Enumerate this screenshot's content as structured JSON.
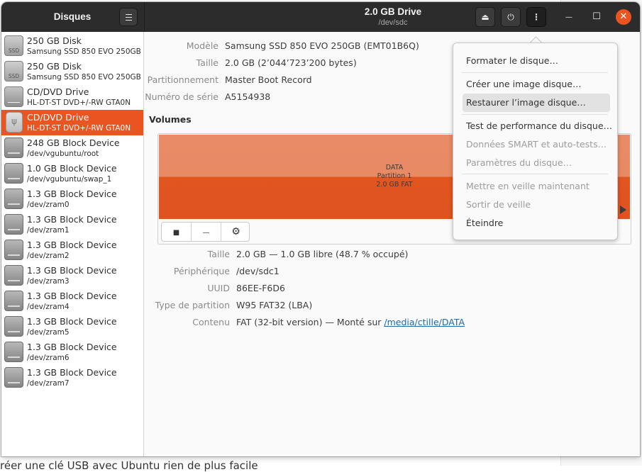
{
  "background": {
    "bottom_text": "réer une clé USB avec Ubuntu rien de plus facile"
  },
  "sidebar_header": {
    "title": "Disques",
    "menu_icon": "hamburger-icon"
  },
  "header": {
    "title": "2.0 GB Drive",
    "subtitle": "/dev/sdc",
    "eject_glyph": "⏏",
    "power_glyph": "⏻",
    "more_glyph": "⋮",
    "minimize_glyph": "—",
    "maximize_glyph": "☐",
    "close_glyph": "✕"
  },
  "devices": [
    {
      "name": "250 GB Disk",
      "sub": "Samsung SSD 850 EVO 250GB",
      "icon": "ssd",
      "icon_label": "SSD"
    },
    {
      "name": "250 GB Disk",
      "sub": "Samsung SSD 850 EVO 250GB",
      "icon": "ssd",
      "icon_label": "SSD"
    },
    {
      "name": "CD/DVD Drive",
      "sub": "HL-DT-ST DVD+/-RW GTA0N",
      "icon": "disc",
      "icon_label": ""
    },
    {
      "name": "CD/DVD Drive",
      "sub": "HL-DT-ST DVD+/-RW GTA0N",
      "icon": "usb",
      "icon_label": "ψ"
    },
    {
      "name": "248 GB Block Device",
      "sub": "/dev/vgubuntu/root",
      "icon": "block",
      "icon_label": ""
    },
    {
      "name": "1.0 GB Block Device",
      "sub": "/dev/vgubuntu/swap_1",
      "icon": "block",
      "icon_label": ""
    },
    {
      "name": "1.3 GB Block Device",
      "sub": "/dev/zram0",
      "icon": "block",
      "icon_label": ""
    },
    {
      "name": "1.3 GB Block Device",
      "sub": "/dev/zram1",
      "icon": "block",
      "icon_label": ""
    },
    {
      "name": "1.3 GB Block Device",
      "sub": "/dev/zram2",
      "icon": "block",
      "icon_label": ""
    },
    {
      "name": "1.3 GB Block Device",
      "sub": "/dev/zram3",
      "icon": "block",
      "icon_label": ""
    },
    {
      "name": "1.3 GB Block Device",
      "sub": "/dev/zram4",
      "icon": "block",
      "icon_label": ""
    },
    {
      "name": "1.3 GB Block Device",
      "sub": "/dev/zram5",
      "icon": "block",
      "icon_label": ""
    },
    {
      "name": "1.3 GB Block Device",
      "sub": "/dev/zram6",
      "icon": "block",
      "icon_label": ""
    },
    {
      "name": "1.3 GB Block Device",
      "sub": "/dev/zram7",
      "icon": "block",
      "icon_label": ""
    }
  ],
  "selected_device": 3,
  "drive_info": {
    "model_label": "Modèle",
    "model_value": "Samsung SSD 850 EVO 250GB (EMT01B6Q)",
    "size_label": "Taille",
    "size_value": "2.0 GB (2’044’723’200 bytes)",
    "partitioning_label": "Partitionnement",
    "partitioning_value": "Master Boot Record",
    "serial_label": "Numéro de série",
    "serial_value": "A5154938"
  },
  "volumes": {
    "title": "Volumes",
    "partition_name": "DATA",
    "partition_number": "Partition 1",
    "partition_size_fs": "2.0 GB FAT",
    "toolbar": {
      "stop_glyph": "■",
      "minus_glyph": "—",
      "gear_glyph": "⚙"
    }
  },
  "partition_info": {
    "size_label": "Taille",
    "size_value": "2.0 GB — 1.0 GB libre (48.7 % occupé)",
    "device_label": "Périphérique",
    "device_value": "/dev/sdc1",
    "uuid_label": "UUID",
    "uuid_value": "86EE-F6D6",
    "type_label": "Type de partition",
    "type_value": "W95 FAT32 (LBA)",
    "contents_label": "Contenu",
    "contents_prefix": "FAT (32-bit version) — Monté sur ",
    "contents_link": "/media/ctille/DATA"
  },
  "menu": {
    "format": "Formater le disque…",
    "create_image": "Créer une image disque…",
    "restore_image": "Restaurer l’image disque…",
    "benchmark": "Test de performance du disque…",
    "smart": "Données SMART et auto-tests…",
    "settings": "Paramètres du disque…",
    "standby": "Mettre en veille maintenant",
    "wakeup": "Sortir de veille",
    "power_off": "Éteindre"
  }
}
